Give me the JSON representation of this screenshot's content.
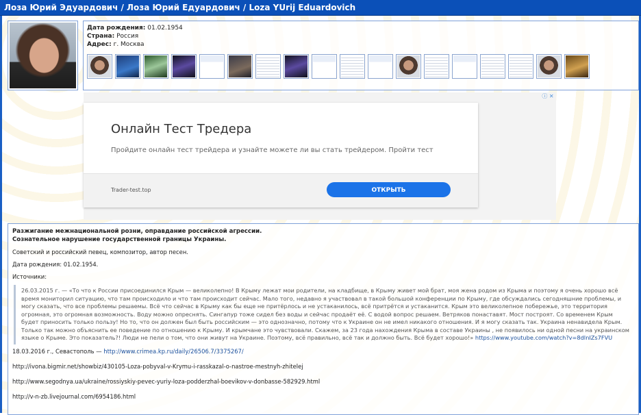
{
  "header": {
    "title": "Лоза Юрий Эдуардович / Лоза Юрий Едуардович / Loza YUrij Eduardovich"
  },
  "info": {
    "birth_label": "Дата рождения:",
    "birth_value": "01.02.1954",
    "country_label": "Страна:",
    "country_value": "Россия",
    "address_label": "Адрес:",
    "address_value": "г. Москва"
  },
  "thumbnails": [
    "photo-icon",
    "photo-icon",
    "photo-icon",
    "photo-icon",
    "document-icon",
    "photo-icon",
    "document-icon",
    "photo-icon",
    "document-icon",
    "document-icon",
    "document-icon",
    "photo-icon",
    "document-icon",
    "document-icon",
    "document-icon",
    "document-icon",
    "photo-icon",
    "photo-icon"
  ],
  "ad": {
    "title": "Онлайн Тест Тредера",
    "text": "Пройдите онлайн тест трейдера и узнайте можете ли вы стать трейдером. Пройти тест",
    "domain": "Trader-test.top",
    "button": "ОТКРЫТЬ",
    "choices": "ⓘ ✕"
  },
  "article": {
    "headline1": "Разжигание межнациональной розни, оправдание российской агрессии.",
    "headline2": "Сознательное нарушение государственной границы Украины.",
    "bio": "Советский и российский певец, композитор, автор песен.",
    "birth": "Дата рождения: 01.02.1954.",
    "sources_label": "Источники:",
    "quote": "26.03.2015 г. — «То что к России присоединился Крым — великолепно! В Крыму лежат мои родители, на кладбище, в Крыму живет мой брат, моя жена родом из Крыма и поэтому я очень хорошо всё время мониторил ситуацию, что там происходило и что там происходит сейчас. Мало того, недавно я участвовал в такой большой конференции по Крыму, где обсуждались сегодняшние проблемы, и могу сказать, что все проблемы решаемы. Всё что сейчас в Крыму как бы еще не притёрлось и не устаканилось, всё притрётся и устаканится. Крым это великолепное побережье, это территория огромная, это огромная возможность. Воду можно опреснять. Сингапур тоже сидел без воды и сейчас продаёт её. С водой вопрос решаем. Ветряков понаставят. Мост построят. Со временем Крым будет приносить только пользу! Но то, что он должен был быть российским — это однозначно, потому что к Украине он не имел никакого отношения. И я могу сказать так. Украина ненавидела Крым. Только так можно объяснить ее поведение по отношению к Крыму. И крымчане это чувствовали. Скажем, за 23 года нахождения Крыма в составе Украины , не появилось ни одной песни на украинском языке о Крыме. Это показатель?! Люди не пели о том, что они живут на Украине. Поэтому, всё правильно, всё так и должно быть. Всё будет хорошо!»",
    "quote_link": "https://www.youtube.com/watch?v=8dInIZs7FVU",
    "source1_prefix": "18.03.2016 г., Севастополь — ",
    "source1_link": "http://www.crimea.kp.ru/daily/26506.7/3375267/",
    "source2": "http://ivona.bigmir.net/showbiz/430105-Loza-pobyval-v-Krymu-i-rasskazal-o-nastroe-mestnyh-zhitelej",
    "source3": "http://www.segodnya.ua/ukraine/rossiyskiy-pevec-yuriy-loza-podderzhal-boevikov-v-donbasse-582929.html",
    "source4": "http://v-n-zb.livejournal.com/6954186.html"
  }
}
